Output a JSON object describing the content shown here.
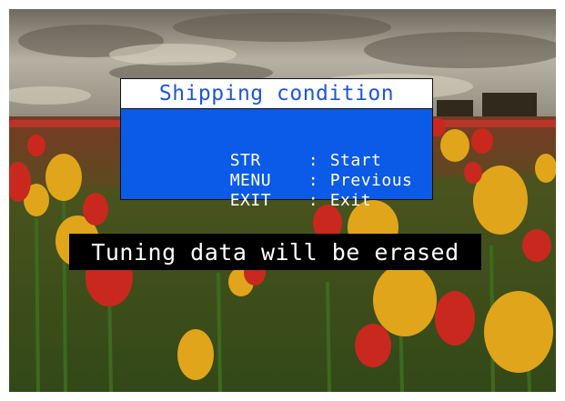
{
  "dialog": {
    "title": "Shipping condition",
    "options": [
      {
        "key": "STR",
        "separator": ":",
        "action": "Start"
      },
      {
        "key": "MENU",
        "separator": ":",
        "action": "Previous"
      },
      {
        "key": "EXIT",
        "separator": ":",
        "action": "Exit"
      }
    ]
  },
  "warning": {
    "message": "Tuning data will be erased"
  },
  "colors": {
    "title_text": "#1f56d6",
    "menu_background": "#0b5ae8",
    "menu_text": "#ffffff",
    "warning_background": "#000000",
    "warning_text": "#ffffff"
  },
  "background": {
    "subject": "tulip field under cloudy sky"
  }
}
